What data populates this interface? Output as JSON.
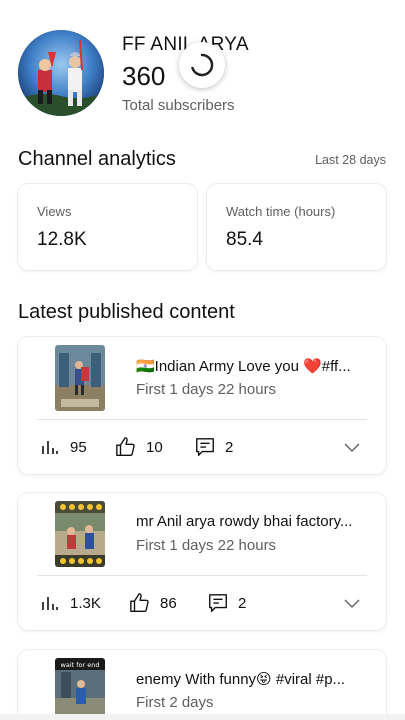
{
  "channel": {
    "name": "FF ANIL ARYA",
    "subscriber_count": "360",
    "subscriber_label": "Total subscribers"
  },
  "analytics": {
    "title": "Channel analytics",
    "range": "Last 28 days",
    "views_label": "Views",
    "views_value": "12.8K",
    "watch_label": "Watch time (hours)",
    "watch_value": "85.4"
  },
  "latest": {
    "title": "Latest published content",
    "items": [
      {
        "title": "🇮🇳Indian Army Love you ❤️#ff...",
        "age": "First 1 days 22 hours",
        "views": "95",
        "likes": "10",
        "comments": "2"
      },
      {
        "title": "mr Anil arya rowdy bhai factory...",
        "age": "First 1 days 22 hours",
        "views": "1.3K",
        "likes": "86",
        "comments": "2"
      },
      {
        "title": "enemy  With funny😝 #viral #p...",
        "age": "First 2 days",
        "thumb_text": "wait for end"
      }
    ]
  },
  "icons": {
    "views": "bar-chart-icon",
    "likes": "thumbs-up-icon",
    "comments": "comment-icon",
    "expand": "chevron-down-icon",
    "loading": "loading-spinner-icon"
  }
}
